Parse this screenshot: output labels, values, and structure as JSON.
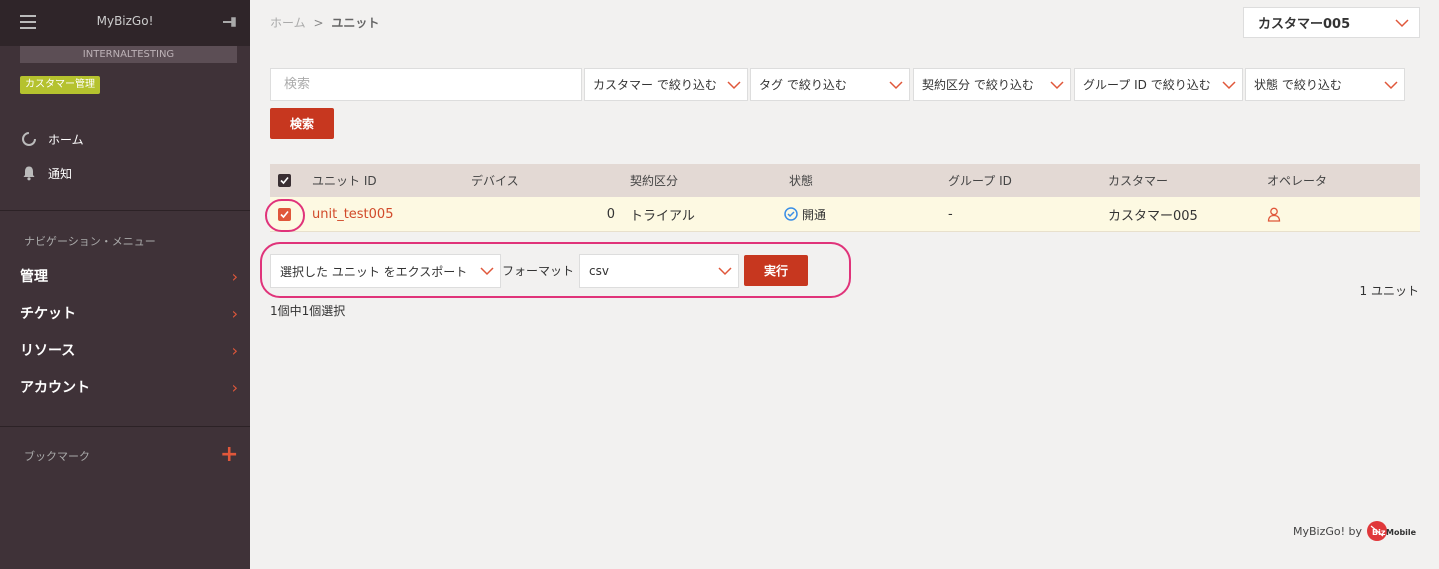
{
  "sidebar": {
    "app_name": "MyBizGo!",
    "env": "INTERNALTESTING",
    "badge": "カスタマー管理",
    "home": "ホーム",
    "notifications": "通知",
    "nav_section": "ナビゲーション・メニュー",
    "nav": [
      "管理",
      "チケット",
      "リソース",
      "アカウント"
    ],
    "bookmark_section": "ブックマーク"
  },
  "header": {
    "breadcrumb_home": "ホーム",
    "breadcrumb_sep": ">",
    "breadcrumb_current": "ユニット",
    "customer": "カスタマー005"
  },
  "filters": {
    "search_placeholder": "検索",
    "customer": "カスタマー で絞り込む",
    "tag": "タグ で絞り込む",
    "contract": "契約区分 で絞り込む",
    "group": "グループ ID で絞り込む",
    "status": "状態 で絞り込む",
    "search_button": "検索"
  },
  "table": {
    "columns": [
      "ユニット ID",
      "デバイス",
      "契約区分",
      "状態",
      "グループ ID",
      "カスタマー",
      "オペレータ"
    ],
    "rows": [
      {
        "unit_id": "unit_test005",
        "device": "0",
        "contract": "トライアル",
        "status": "開通",
        "group": "-",
        "customer": "カスタマー005"
      }
    ]
  },
  "export": {
    "action": "選択した ユニット をエクスポート",
    "format_label": "フォーマット",
    "format": "csv",
    "run_button": "実行",
    "count": "1 ユニット",
    "selected": "1個中1個選択"
  },
  "footer": {
    "text": "MyBizGo! by",
    "logo_text": "BizMobile"
  },
  "colors": {
    "accent": "#c7371f",
    "sidebar": "#3f3238",
    "highlight": "#e0337a",
    "badge": "#b5c22e"
  }
}
